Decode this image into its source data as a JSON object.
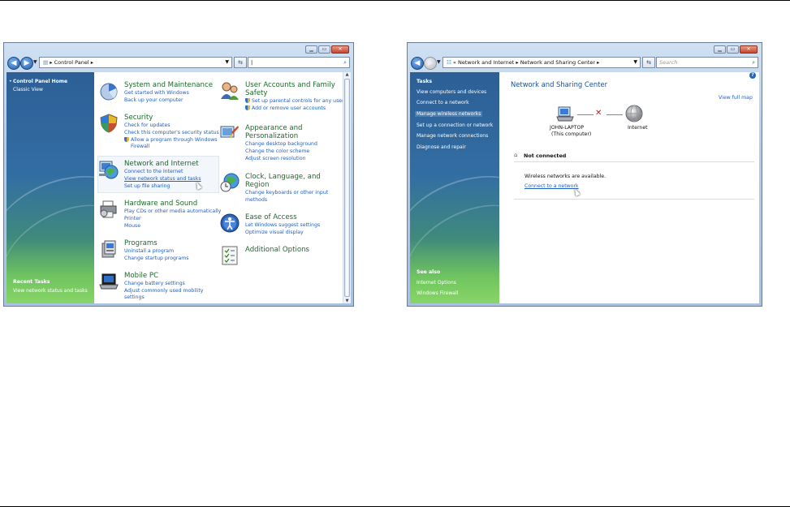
{
  "left_window": {
    "address": {
      "crumb": "Control Panel"
    },
    "sidebar": {
      "home": "Control Panel Home",
      "classic": "Classic View",
      "recent_heading": "Recent Tasks",
      "recent_item": "View network status and tasks"
    },
    "categories": [
      {
        "title": "System and Maintenance",
        "links": [
          "Get started with Windows",
          "Back up your computer"
        ],
        "icon": "system-maintenance-icon"
      },
      {
        "title": "Security",
        "links": [
          "Check for updates",
          "Check this computer's security status",
          "Allow a program through Windows",
          "Firewall"
        ],
        "icon": "security-shield-icon"
      },
      {
        "title": "Network and Internet",
        "links": [
          "Connect to the Internet",
          "View network status and tasks",
          "Set up file sharing"
        ],
        "icon": "network-globe-icon"
      },
      {
        "title": "Hardware and Sound",
        "links": [
          "Play CDs or other media automatically",
          "Printer",
          "Mouse"
        ],
        "icon": "hardware-printer-icon"
      },
      {
        "title": "Programs",
        "links": [
          "Uninstall a program",
          "Change startup programs"
        ],
        "icon": "programs-icon"
      },
      {
        "title": "Mobile PC",
        "links": [
          "Change battery settings",
          "Adjust commonly used mobility",
          "settings"
        ],
        "icon": "mobile-pc-icon"
      },
      {
        "title": "User Accounts and Family",
        "title2": "Safety",
        "links": [
          "Set up parental controls for any user",
          "Add or remove user accounts"
        ],
        "icon": "user-accounts-icon"
      },
      {
        "title": "Appearance and",
        "title2": "Personalization",
        "links": [
          "Change desktop background",
          "Change the color scheme",
          "Adjust screen resolution"
        ],
        "icon": "appearance-icon"
      },
      {
        "title": "Clock, Language, and",
        "title2": "Region",
        "links": [
          "Change keyboards or other input",
          "methods"
        ],
        "icon": "clock-globe-icon"
      },
      {
        "title": "Ease of Access",
        "links": [
          "Let Windows suggest settings",
          "Optimize visual display"
        ],
        "icon": "ease-of-access-icon"
      },
      {
        "title": "Additional Options",
        "links": [],
        "icon": "additional-options-icon"
      }
    ]
  },
  "right_window": {
    "address": {
      "prefix": "«",
      "crumb1": "Network and Internet",
      "crumb2": "Network and Sharing Center"
    },
    "search_placeholder": "Search",
    "sidebar": {
      "tasks_heading": "Tasks",
      "tasks": [
        "View computers and devices",
        "Connect to a network",
        "Manage wireless networks",
        "Set up a connection or network",
        "Manage network connections",
        "Diagnose and repair"
      ],
      "see_also_heading": "See also",
      "see_also": [
        "Internet Options",
        "Windows Firewall"
      ]
    },
    "main": {
      "title": "Network and Sharing Center",
      "view_full_map": "View full map",
      "computer_name": "JOHN-LAPTOP",
      "computer_sub": "(This computer)",
      "internet_label": "Internet",
      "status": "Not connected",
      "message": "Wireless networks are available.",
      "connect_link": "Connect to a network"
    }
  }
}
